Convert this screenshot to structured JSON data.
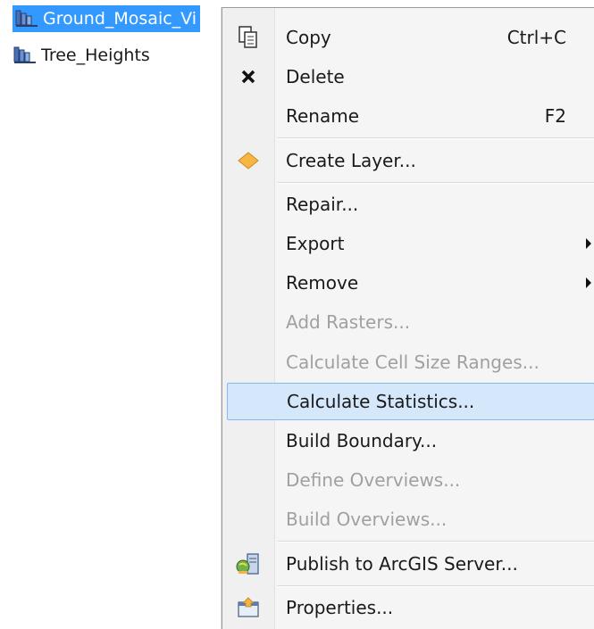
{
  "tree": {
    "items": [
      {
        "label": "Ground_Mosaic_Vi",
        "icon": "mosaic-dataset-icon",
        "selected": true
      },
      {
        "label": "Tree_Heights",
        "icon": "mosaic-dataset-icon",
        "selected": false
      }
    ]
  },
  "context_menu": {
    "copy": {
      "label": "Copy",
      "shortcut": "Ctrl+C",
      "icon": "copy-icon"
    },
    "delete": {
      "label": "Delete",
      "icon": "delete-x-icon"
    },
    "rename": {
      "label": "Rename",
      "shortcut": "F2"
    },
    "create_layer": {
      "label": "Create Layer...",
      "icon": "layer-diamond-icon"
    },
    "repair": {
      "label": "Repair..."
    },
    "export": {
      "label": "Export",
      "submenu": true
    },
    "remove": {
      "label": "Remove",
      "submenu": true
    },
    "add_rasters": {
      "label": "Add Rasters...",
      "disabled": true
    },
    "calc_cell_size": {
      "label": "Calculate Cell Size Ranges...",
      "disabled": true
    },
    "calc_statistics": {
      "label": "Calculate Statistics...",
      "highlighted": true
    },
    "build_boundary": {
      "label": "Build Boundary..."
    },
    "define_overviews": {
      "label": "Define Overviews...",
      "disabled": true
    },
    "build_overviews": {
      "label": "Build Overviews...",
      "disabled": true
    },
    "publish": {
      "label": "Publish to ArcGIS Server...",
      "icon": "publish-server-icon"
    },
    "properties": {
      "label": "Properties...",
      "icon": "properties-icon"
    }
  },
  "colors": {
    "selection": "#3399ff",
    "menu_highlight": "#d5e7fb",
    "menu_highlight_border": "#84b8ee",
    "disabled_text": "#a0a0a0",
    "create_layer_icon": "#f5b642"
  }
}
